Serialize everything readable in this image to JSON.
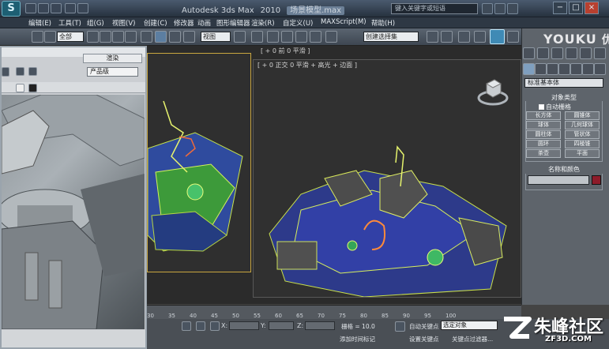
{
  "window": {
    "app_logo": "S",
    "title_parts": [
      "Autodesk 3ds Max",
      "2010"
    ],
    "file_name": "场景模型.max",
    "search_placeholder": "键入关键字或短语",
    "buttons": {
      "minimize": "−",
      "maximize": "□",
      "close": "×"
    }
  },
  "menu": {
    "items": [
      "编辑(E)",
      "工具(T)",
      "组(G)",
      "视图(V)",
      "创建(C)",
      "修改器",
      "动画",
      "图形编辑器",
      "渲染(R)",
      "自定义(U)",
      "MAXScript(M)",
      "帮助(H)"
    ]
  },
  "toolbar": {
    "selection_filter": "全部",
    "ref_coord": "视图",
    "named_selection": "创建选择集"
  },
  "viewports": {
    "top_label": "[ + 0 前 0 平滑 ]",
    "persp_label": "[ + 0 正交 0 平滑 + 高光 + 边面 ]"
  },
  "command_panel": {
    "category": "标准基本体",
    "object_type_title": "对象类型",
    "autogrid_label": "自动栅格",
    "object_buttons": [
      "长方体",
      "圆锥体",
      "球体",
      "几何球体",
      "圆柱体",
      "管状体",
      "圆环",
      "四棱锥",
      "茶壶",
      "平面"
    ],
    "name_color_title": "名称和颜色",
    "color_swatch": "#8d1b2a"
  },
  "render_dialog": {
    "render_button": "渲染",
    "preset": "产品级"
  },
  "timeline": {
    "ticks": [
      "30",
      "35",
      "40",
      "45",
      "50",
      "55",
      "60",
      "65",
      "70",
      "75",
      "80",
      "85",
      "90",
      "95",
      "100"
    ]
  },
  "statusbar": {
    "x_label": "X:",
    "y_label": "Y:",
    "z_label": "Z:",
    "grid_label": "栅格 = 10.0",
    "add_time_tag": "添加时间标记",
    "auto_key": "自动关键点",
    "key_mode": "选定对象",
    "set_key": "设置关键点",
    "key_filters": "关键点过滤器..."
  },
  "watermarks": {
    "youku": "YOUKU",
    "youku_cn": "优酷",
    "site_name": "朱峰社区",
    "site_url": "ZF3D.COM"
  }
}
